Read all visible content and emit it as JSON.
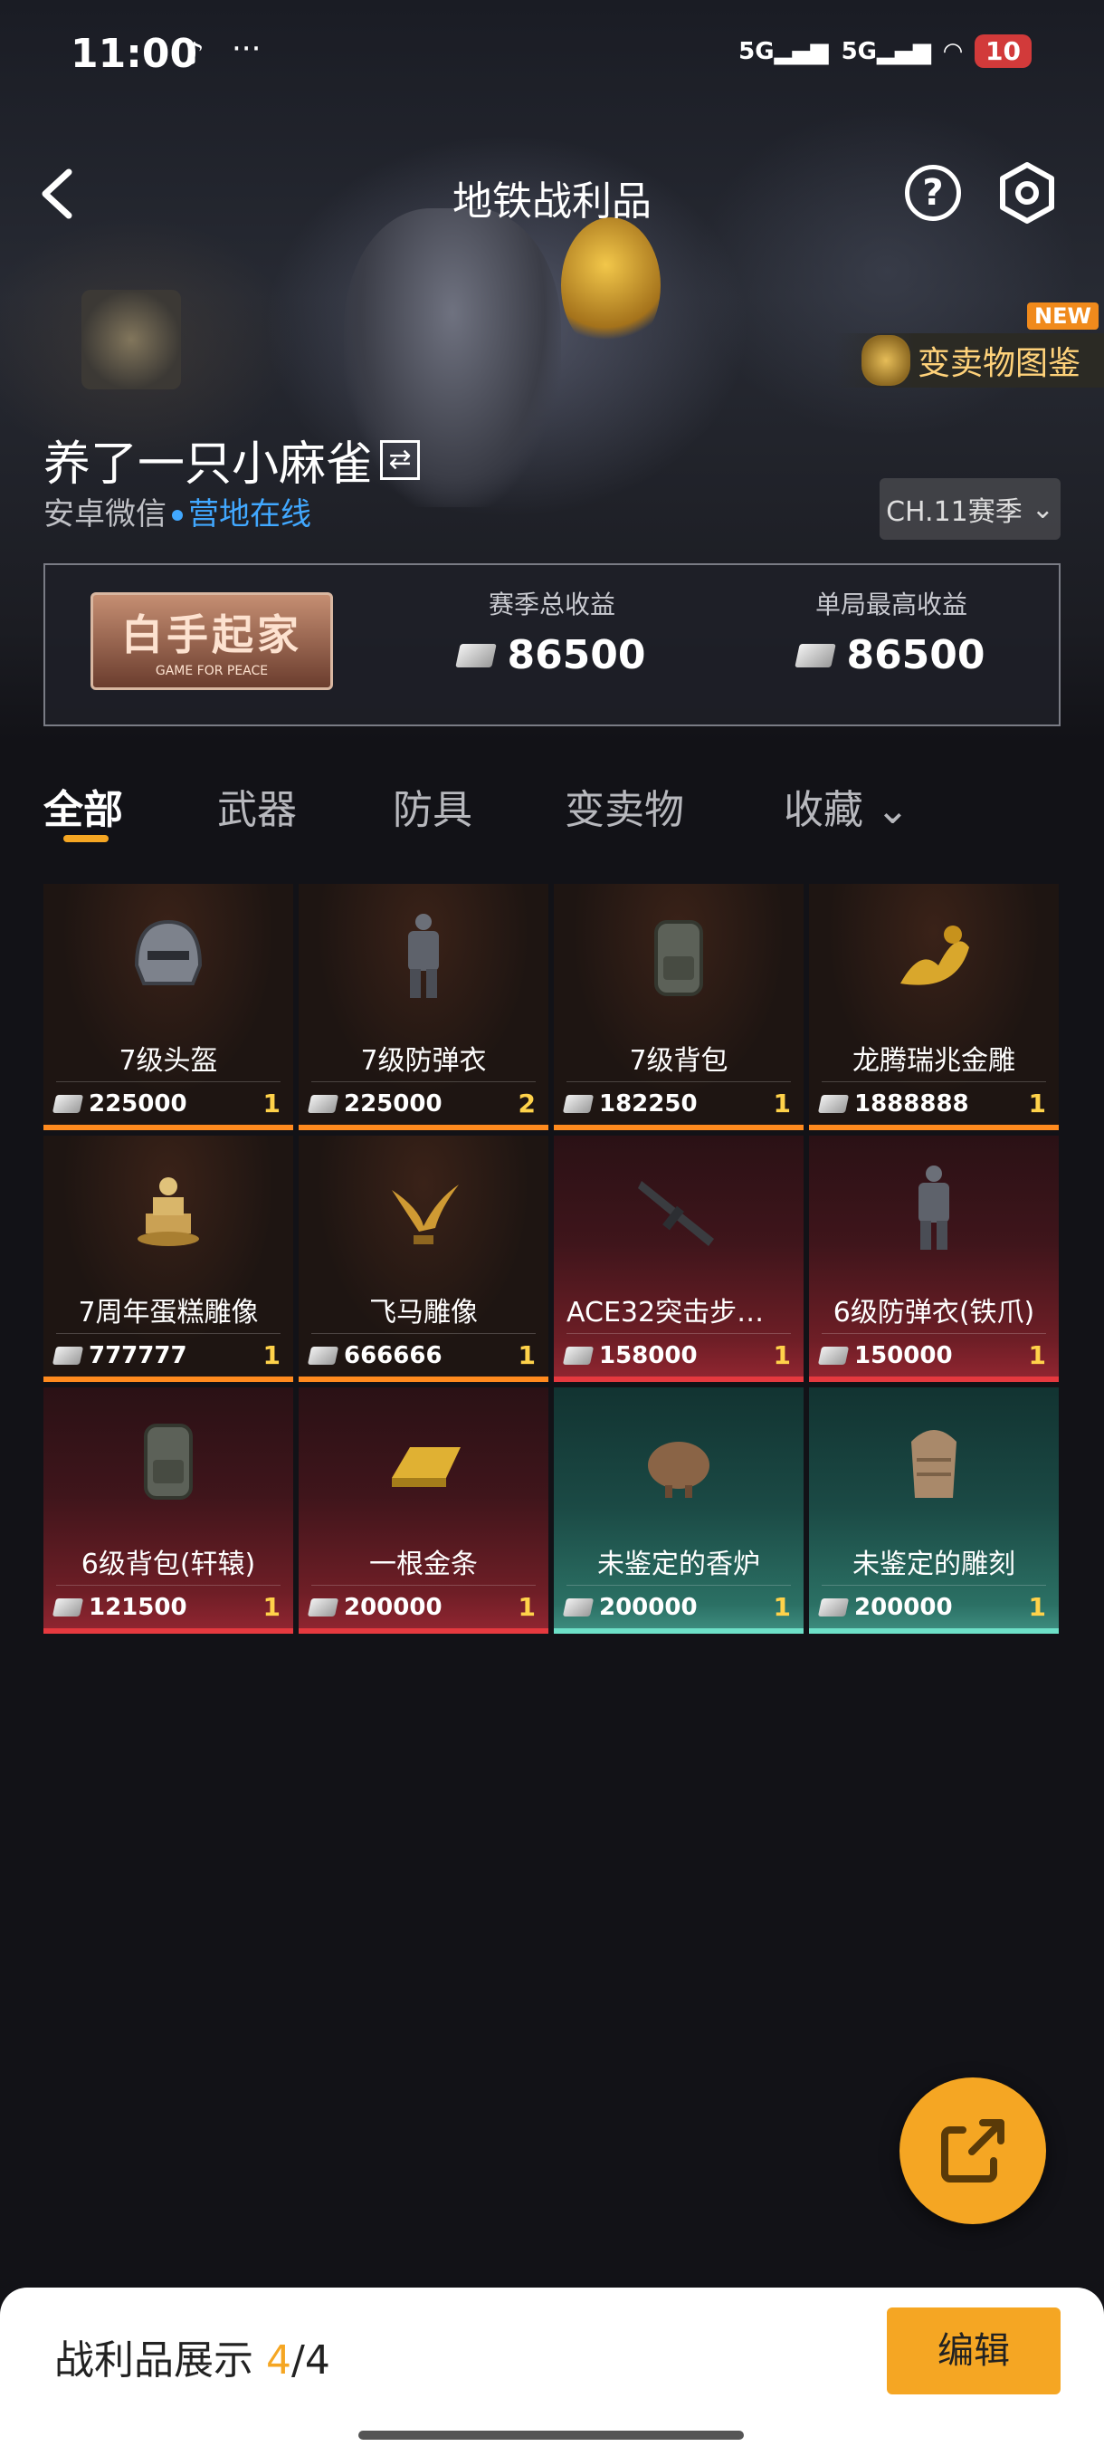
{
  "status_bar": {
    "time": "11:00",
    "dots": "···",
    "signal_1": "5G",
    "signal_2": "5G",
    "battery": "10"
  },
  "header": {
    "title": "地铁战利品"
  },
  "collection_button": {
    "label": "变卖物图鉴",
    "badge": "NEW"
  },
  "profile": {
    "username": "养了一只小麻雀",
    "platform": "安卓微信",
    "status": "营地在线",
    "season_select": "CH.11赛季"
  },
  "stats": {
    "badge_title": "白手起家",
    "badge_subtitle": "GAME FOR PEACE",
    "season_total_label": "赛季总收益",
    "season_total_value": "86500",
    "single_best_label": "单局最高收益",
    "single_best_value": "86500"
  },
  "tabs": [
    {
      "label": "全部"
    },
    {
      "label": "武器"
    },
    {
      "label": "防具"
    },
    {
      "label": "变卖物"
    },
    {
      "label": "收藏"
    }
  ],
  "items": [
    {
      "name": "7级头盔",
      "value": "225000",
      "count": "1",
      "rarity": "orange",
      "icon": "helmet-icon"
    },
    {
      "name": "7级防弹衣",
      "value": "225000",
      "count": "2",
      "rarity": "orange",
      "icon": "armor-vest-icon"
    },
    {
      "name": "7级背包",
      "value": "182250",
      "count": "1",
      "rarity": "orange",
      "icon": "backpack-icon"
    },
    {
      "name": "龙腾瑞兆金雕",
      "value": "1888888",
      "count": "1",
      "rarity": "orange",
      "icon": "gold-dragon-icon"
    },
    {
      "name": "7周年蛋糕雕像",
      "value": "777777",
      "count": "1",
      "rarity": "orange",
      "icon": "cake-statue-icon"
    },
    {
      "name": "飞马雕像",
      "value": "666666",
      "count": "1",
      "rarity": "orange",
      "icon": "pegasus-statue-icon"
    },
    {
      "name": "ACE32突击步枪…",
      "value": "158000",
      "count": "1",
      "rarity": "red",
      "icon": "rifle-icon"
    },
    {
      "name": "6级防弹衣(铁爪)",
      "value": "150000",
      "count": "1",
      "rarity": "red",
      "icon": "armor-vest-icon"
    },
    {
      "name": "6级背包(轩辕)",
      "value": "121500",
      "count": "1",
      "rarity": "red",
      "icon": "backpack-icon"
    },
    {
      "name": "一根金条",
      "value": "200000",
      "count": "1",
      "rarity": "red",
      "icon": "gold-bar-icon"
    },
    {
      "name": "未鉴定的香炉",
      "value": "200000",
      "count": "1",
      "rarity": "teal",
      "icon": "censer-icon"
    },
    {
      "name": "未鉴定的雕刻",
      "value": "200000",
      "count": "1",
      "rarity": "teal",
      "icon": "carving-icon"
    }
  ],
  "bottom_sheet": {
    "showcase_label": "战利品展示",
    "showcase_current": "4",
    "showcase_total": "/4",
    "edit_label": "编辑"
  },
  "colors": {
    "accent": "#f5a623",
    "online_blue": "#41a8ff",
    "rarity_orange": "#ff8a1e",
    "rarity_red": "#e6393f",
    "rarity_teal": "#6de0c8"
  }
}
